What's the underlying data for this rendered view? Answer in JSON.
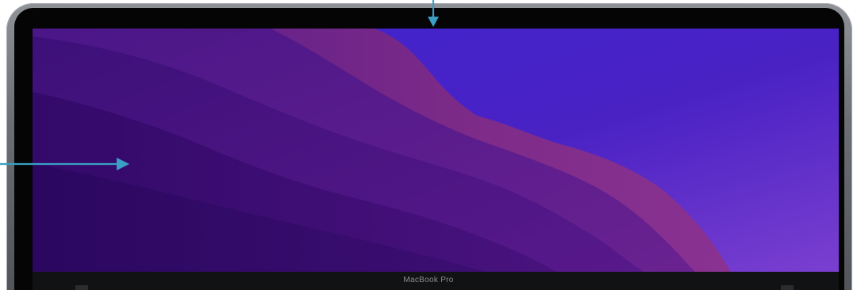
{
  "device": {
    "model_label": "MacBook Pro"
  },
  "wallpaper": {
    "theme": "macOS Monterey purple waves",
    "colors": {
      "sky_top": "#3f24c9",
      "sky_right": "#5a2fd0",
      "ridge_magenta": "#7d2a86",
      "ridge_violet": "#5e1b7e",
      "valley_dark": "#2c0a5c",
      "valley_deep": "#3a0f70"
    }
  },
  "annotations": {
    "arrow_color": "#3a9fc4",
    "items": [
      {
        "name": "camera-pointer",
        "direction": "down"
      },
      {
        "name": "screen-pointer",
        "direction": "right"
      }
    ]
  }
}
